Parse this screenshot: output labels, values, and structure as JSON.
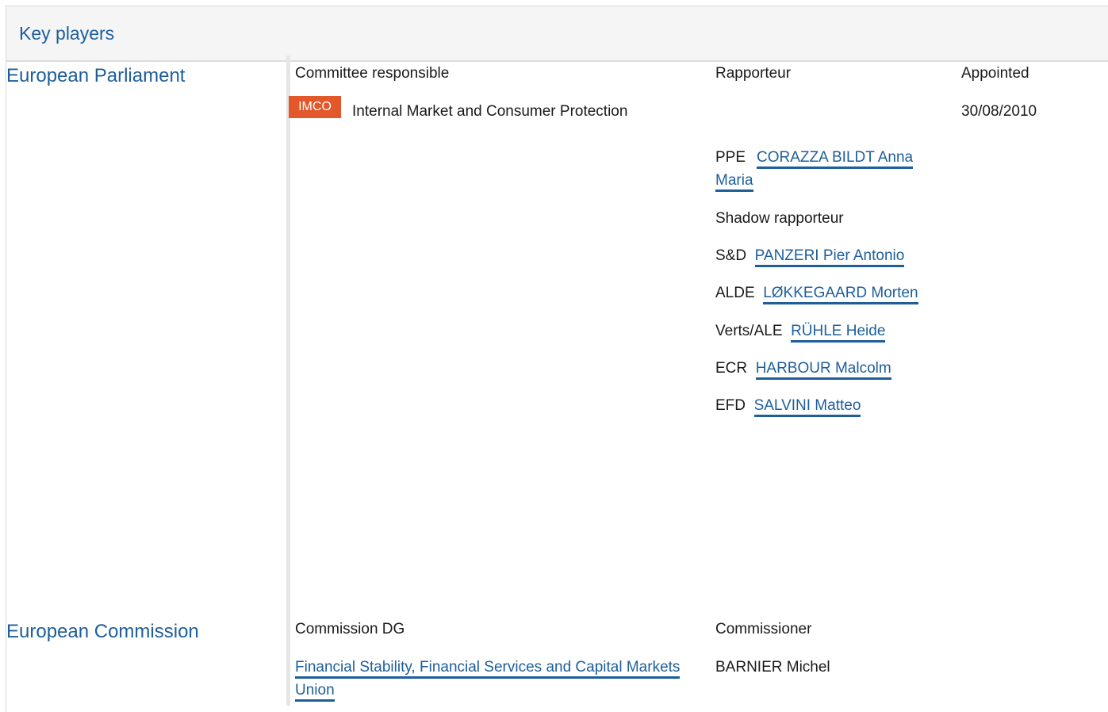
{
  "header": {
    "title": "Key players"
  },
  "parliament": {
    "institution": "European Parliament",
    "col_committee": "Committee responsible",
    "col_rapporteur": "Rapporteur",
    "col_appointed": "Appointed",
    "committee_code": "IMCO",
    "committee_name": "Internal Market and Consumer Protection",
    "appointed_date": "30/08/2010",
    "rapporteur": {
      "group": "PPE",
      "name": "CORAZZA BILDT Anna Maria"
    },
    "shadow_label": "Shadow rapporteur",
    "shadows": [
      {
        "group": "S&D",
        "name": "PANZERI Pier Antonio"
      },
      {
        "group": "ALDE",
        "name": "LØKKEGAARD Morten"
      },
      {
        "group": "Verts/ALE",
        "name": "RÜHLE Heide"
      },
      {
        "group": "ECR",
        "name": "HARBOUR Malcolm"
      },
      {
        "group": "EFD",
        "name": "SALVINI Matteo"
      }
    ]
  },
  "commission": {
    "institution": "European Commission",
    "col_dg": "Commission DG",
    "col_commissioner": "Commissioner",
    "dg_name": "Financial Stability, Financial Services and Capital Markets Union",
    "commissioner": "BARNIER Michel"
  },
  "colors": {
    "link": "#1d5e9b",
    "badge": "#e3582a",
    "header_bg": "#f5f5f5"
  }
}
